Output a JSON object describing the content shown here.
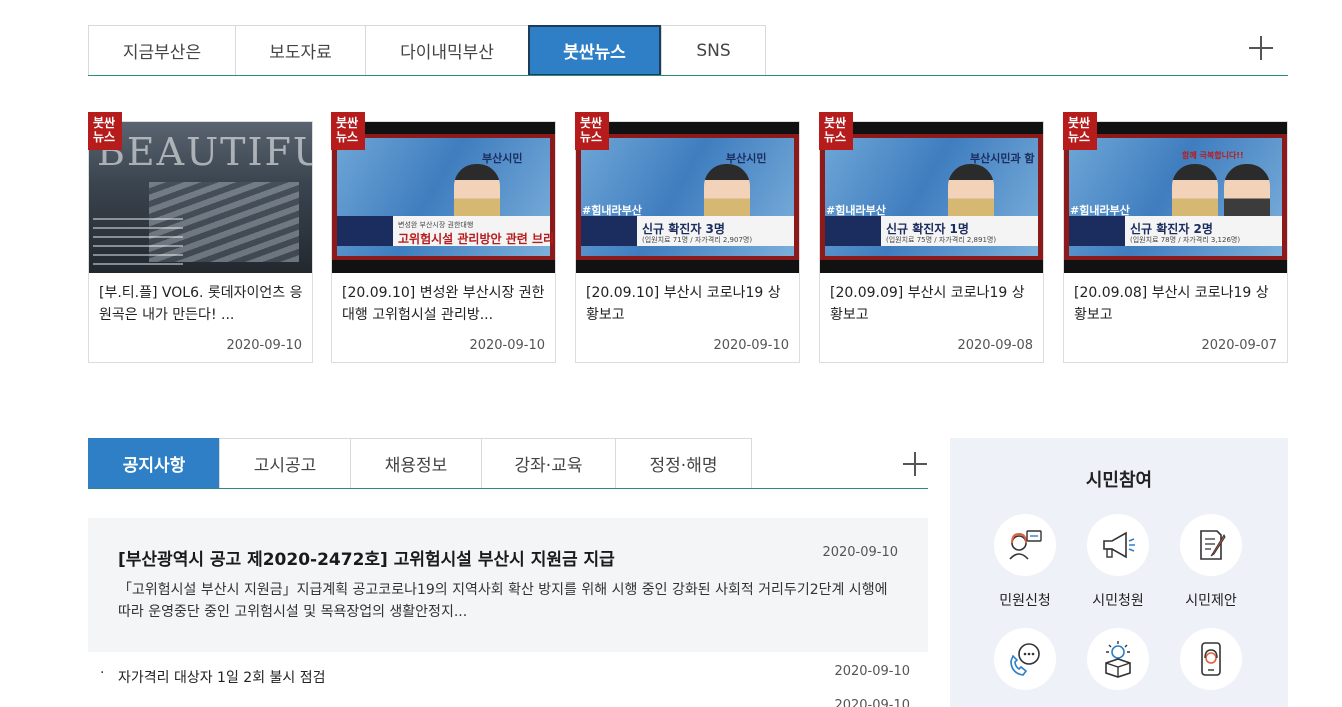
{
  "news_tabs": {
    "items": [
      "지금부산은",
      "보도자료",
      "다이내믹부산",
      "붓싼뉴스",
      "SNS"
    ],
    "active_index": 3,
    "more_icon": "plus-icon"
  },
  "news_cards": [
    {
      "badge": "붓싼\n뉴스",
      "thumb_text": "BEAUTIFUL",
      "title": "[부.티.플] VOL6. 롯데자이언츠 응원곡은 내가 만든다! ...",
      "date": "2020-09-10"
    },
    {
      "badge": "붓싼\n뉴스",
      "thumb_caption": "고위험시설 관리방안 관련 브리핑",
      "thumb_sub": "변성완 부산시장 권한대행",
      "thumb_tag": "부산시민",
      "title": "[20.09.10] 변성완 부산시장 권한대행 고위험시설 관리방...",
      "date": "2020-09-10"
    },
    {
      "badge": "붓싼\n뉴스",
      "thumb_caption": "신규 확진자 3명",
      "thumb_sub": "(입원치료 71명 / 자가격리 2,907명)",
      "thumb_tag": "#힘내라부산",
      "thumb_tag2": "부산시민",
      "title": "[20.09.10] 부산시 코로나19 상황보고",
      "date": "2020-09-10"
    },
    {
      "badge": "붓싼\n뉴스",
      "thumb_caption": "신규 확진자 1명",
      "thumb_sub": "(입원치료 75명 / 자가격리 2,891명)",
      "thumb_tag": "#힘내라부산",
      "thumb_tag2": "부산시민과 함",
      "title": "[20.09.09] 부산시 코로나19 상황보고",
      "date": "2020-09-08"
    },
    {
      "badge": "붓싼\n뉴스",
      "thumb_caption": "신규 확진자 2명",
      "thumb_sub": "(입원치료 78명 / 자가격리 3,126명)",
      "thumb_tag": "#힘내라부산",
      "thumb_tag2": "함께 극복합니다!!",
      "title": "[20.09.08] 부산시 코로나19 상황보고",
      "date": "2020-09-07"
    }
  ],
  "notice_tabs": {
    "items": [
      "공지사항",
      "고시공고",
      "채용정보",
      "강좌·교육",
      "정정·해명"
    ],
    "active_index": 0,
    "more_icon": "plus-icon"
  },
  "featured_notice": {
    "title": "[부산광역시 공고 제2020-2472호] 고위험시설 부산시 지원금 지급",
    "date": "2020-09-10",
    "body": "「고위험시설 부산시 지원금」지급계획 공고코로나19의 지역사회 확산 방지를 위해 시행 중인 강화된 사회적 거리두기2단계 시행에 따라 운영중단 중인 고위험시설 및 목욕장업의 생활안정지..."
  },
  "notice_list": [
    {
      "bullet": "·",
      "title": "자가격리 대상자 1일 2회 불시 점검",
      "date": "2020-09-10"
    },
    {
      "bullet": "·",
      "title": "",
      "date": "2020-09-10"
    }
  ],
  "citizen": {
    "title": "시민참여",
    "items": [
      {
        "label": "민원신청",
        "icon": "consultant-icon"
      },
      {
        "label": "시민청원",
        "icon": "megaphone-icon"
      },
      {
        "label": "시민제안",
        "icon": "document-pen-icon"
      },
      {
        "label": "",
        "icon": "phone-chat-icon"
      },
      {
        "label": "",
        "icon": "idea-box-icon"
      },
      {
        "label": "",
        "icon": "mobile-support-icon"
      }
    ]
  },
  "colors": {
    "active_tab": "#2f7fc6",
    "badge": "#b71c1c",
    "tab_baseline": "#2a8c7a",
    "citizen_bg": "#eef2f8"
  }
}
